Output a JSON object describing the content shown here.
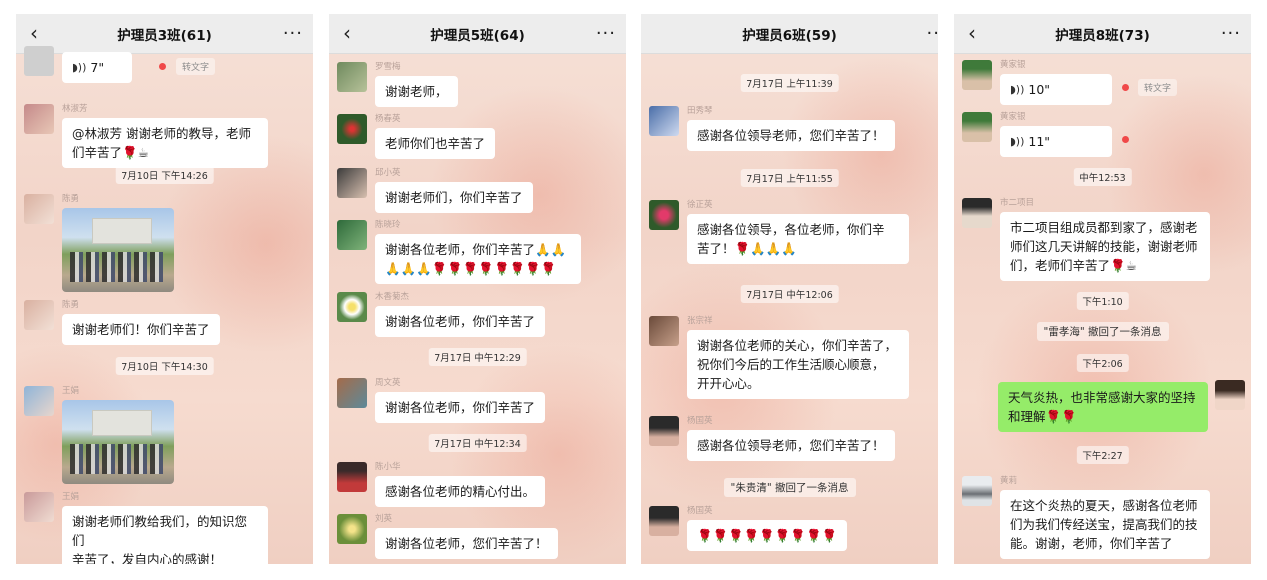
{
  "colors": {
    "titlebar": "#ededed",
    "bubble": "#ffffff",
    "self_bubble": "#95ec69",
    "unread_dot": "#f04848"
  },
  "icons": {
    "back": "chevron-left-icon",
    "more": "more-icon",
    "voice": "voice-wave-icon"
  },
  "panels": [
    {
      "title": "护理员3班(61)",
      "msgs": {
        "voice": {
          "duration": "7\"",
          "totext": "转文字"
        },
        "m1_sender": "林淑芳",
        "m1_text1": "@林淑芳  谢谢老师的教导，老师",
        "m1_text2": "们辛苦了🌹☕",
        "time1": "7月10日 下午14:26",
        "m2_sender": "陈勇",
        "m3_sender": "陈勇",
        "m3_text": "谢谢老师们！你们辛苦了",
        "time2": "7月10日 下午14:30",
        "m4_sender": "王娟",
        "m5_sender": "王娟",
        "m5_text1": "谢谢老师们教给我们，的知识您们",
        "m5_text2": "辛苦了，发自内心的感谢！"
      }
    },
    {
      "title": "护理员5班(64)",
      "msgs": {
        "m1_sender": "罗雪梅",
        "m1_text": "谢谢老师，",
        "m2_sender": "杨春英",
        "m2_text": "老师你们也辛苦了",
        "m3_sender": "邱小英",
        "m3_text": "谢谢老师们，你们辛苦了",
        "m4_sender": "陈晓玲",
        "m4_text1": "谢谢各位老师，你们辛苦了🙏🙏",
        "m4_text2": "🙏🙏🙏🌹🌹🌹🌹🌹🌹🌹🌹",
        "m5_sender": "木香菊杰",
        "m5_text": "谢谢各位老师，你们辛苦了",
        "time1": "7月17日 中午12:29",
        "m6_sender": "周文英",
        "m6_text": "谢谢各位老师，你们辛苦了",
        "time2": "7月17日 中午12:34",
        "m7_sender": "陈小华",
        "m7_text": "感谢各位老师的精心付出。",
        "m8_sender": "刘英",
        "m8_text": "谢谢各位老师，您们辛苦了！"
      }
    },
    {
      "title": "护理员6班(59)",
      "msgs": {
        "time1": "7月17日 上午11:39",
        "m1_sender": "田秀琴",
        "m1_text": "感谢各位领导老师，您们辛苦了！",
        "time2": "7月17日 上午11:55",
        "m2_sender": "徐正英",
        "m2_text1": "感谢各位领导，各位老师，你们辛",
        "m2_text2": "苦了！🌹🙏🙏🙏",
        "time3": "7月17日 中午12:06",
        "m3_sender": "张宗祥",
        "m3_text1": "谢谢各位老师的关心，你们辛苦了，",
        "m3_text2": "祝你们今后的工作生活顺心顺意，",
        "m3_text3": "开开心心。",
        "m4_sender": "杨国英",
        "m4_text": "感谢各位领导老师，您们辛苦了！",
        "sys1": "\"朱贵清\" 撤回了一条消息",
        "m5_sender": "杨国英",
        "m5_text": "🌹🌹🌹🌹🌹🌹🌹🌹🌹"
      }
    },
    {
      "title": "护理员8班(73)",
      "msgs": {
        "v1_sender": "黄家银",
        "v1_duration": "10\"",
        "v1_totext": "转文字",
        "v2_sender": "黄家银",
        "v2_duration": "11\"",
        "time1": "中午12:53",
        "m1_sender": "市二项目",
        "m1_text1": "市二项目组成员都到家了，感谢老",
        "m1_text2": "师们这几天讲解的技能，谢谢老师",
        "m1_text3": "们，老师们辛苦了🌹☕",
        "time2": "下午1:10",
        "sys1": "\"雷孝海\" 撤回了一条消息",
        "time3": "下午2:06",
        "self_text1": "天气炎热，也非常感谢大家的坚持",
        "self_text2": "和理解🌹🌹",
        "time4": "下午2:27",
        "m2_sender": "黄莉",
        "m2_text1": "在这个炎热的夏天，感谢各位老师",
        "m2_text2": "们为我们传经送宝，提高我们的技",
        "m2_text3": "能。谢谢，老师，你们辛苦了"
      }
    }
  ]
}
